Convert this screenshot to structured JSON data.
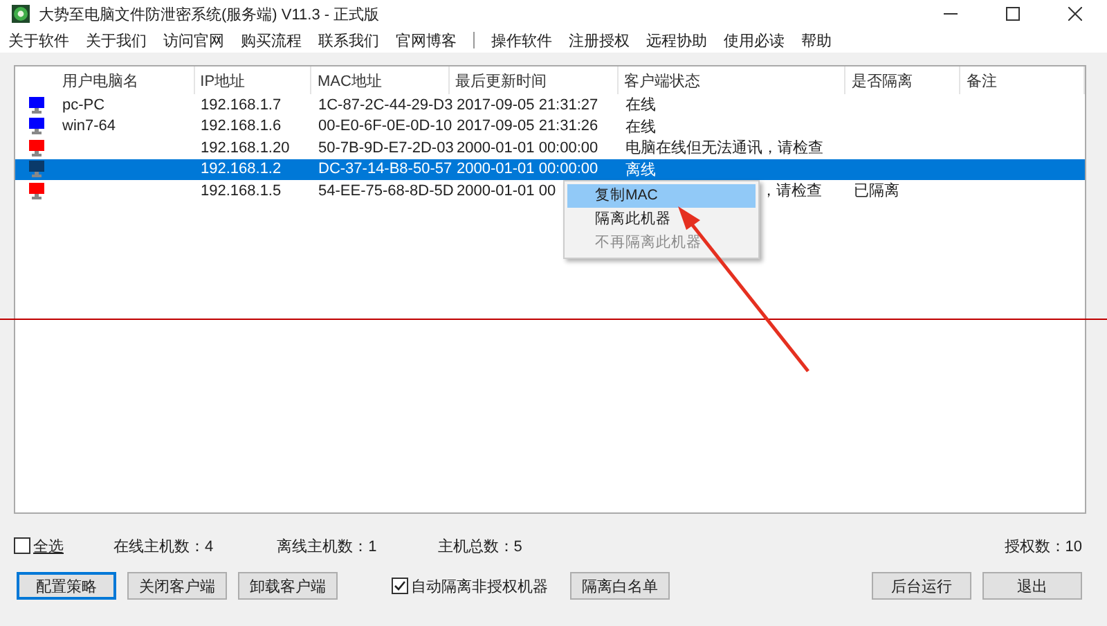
{
  "window": {
    "title": "大势至电脑文件防泄密系统(服务端) V11.3 - 正式版"
  },
  "menu": [
    {
      "label": "关于软件"
    },
    {
      "label": "关于我们"
    },
    {
      "label": "访问官网"
    },
    {
      "label": "购买流程"
    },
    {
      "label": "联系我们"
    },
    {
      "label": "官网博客",
      "separator_after": true
    },
    {
      "label": "操作软件"
    },
    {
      "label": "注册授权"
    },
    {
      "label": "远程协助"
    },
    {
      "label": "使用必读"
    },
    {
      "label": "帮助"
    }
  ],
  "table": {
    "columns": [
      "用户电脑名",
      "IP地址",
      "MAC地址",
      "最后更新时间",
      "客户端状态",
      "是否隔离",
      "备注"
    ],
    "rows": [
      {
        "color": "#0000ff",
        "selected": false,
        "name": "pc-PC",
        "ip": "192.168.1.7",
        "mac": "1C-87-2C-44-29-D3",
        "time": "2017-09-05 21:31:27",
        "status": "在线",
        "isolated": ""
      },
      {
        "color": "#0000ff",
        "selected": false,
        "name": "win7-64",
        "ip": "192.168.1.6",
        "mac": "00-E0-6F-0E-0D-10",
        "time": "2017-09-05 21:31:26",
        "status": "在线",
        "isolated": ""
      },
      {
        "color": "#ff0000",
        "selected": false,
        "name": "",
        "ip": "192.168.1.20",
        "mac": "50-7B-9D-E7-2D-03",
        "time": "2000-01-01 00:00:00",
        "status": "电脑在线但无法通讯，请检查",
        "isolated": ""
      },
      {
        "color": "#0a3a6a",
        "selected": true,
        "name": "",
        "ip": "192.168.1.2",
        "mac": "DC-37-14-B8-50-57",
        "time": "2000-01-01 00:00:00",
        "status": "离线",
        "isolated": ""
      },
      {
        "color": "#ff0000",
        "selected": false,
        "name": "",
        "ip": "192.168.1.5",
        "mac": "54-EE-75-68-8D-5D",
        "time": "2000-01-01 00",
        "status": "，请检查",
        "isolated": "已隔离"
      }
    ]
  },
  "context_menu": [
    {
      "label": "复制MAC",
      "selected": true,
      "disabled": false
    },
    {
      "label": "隔离此机器",
      "selected": false,
      "disabled": false
    },
    {
      "label": "不再隔离此机器",
      "selected": false,
      "disabled": true
    }
  ],
  "stats": {
    "select_all": {
      "label": "全选",
      "checked": false
    },
    "online": "在线主机数：4",
    "offline": "离线主机数：1",
    "total": "主机总数：5",
    "licenses": "授权数：10"
  },
  "buttons_left": [
    {
      "label": "配置策略",
      "focused": true
    },
    {
      "label": "关闭客户端",
      "focused": false
    },
    {
      "label": "卸载客户端",
      "focused": false
    }
  ],
  "auto_isolate": {
    "label": "自动隔离非授权机器",
    "checked": true
  },
  "buttons_right": [
    {
      "label": "隔离白名单",
      "focused": false
    },
    {
      "label": "后台运行",
      "focused": false
    },
    {
      "label": "退出",
      "focused": false
    }
  ]
}
